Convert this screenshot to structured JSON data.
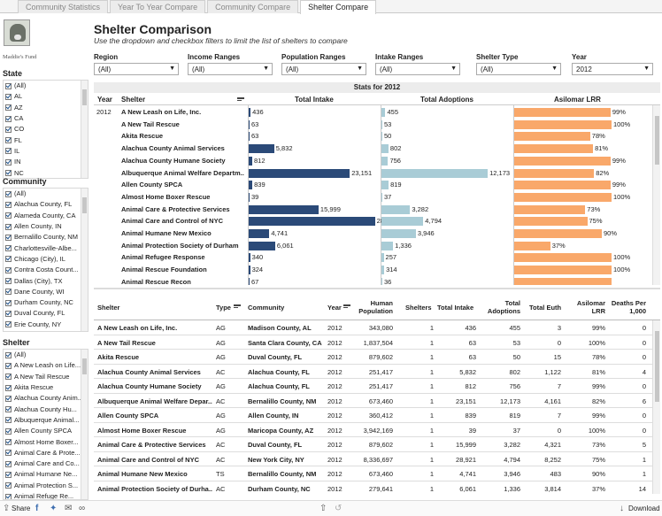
{
  "tabs": [
    {
      "label": "Community Statistics"
    },
    {
      "label": "Year To Year Compare"
    },
    {
      "label": "Community Compare"
    },
    {
      "label": "Shelter Compare"
    }
  ],
  "logo_text": "Maddie's Fund",
  "page_title": "Shelter Comparison",
  "subtitle": "Use the dropdown and checkbox filters to limit the list of shelters to compare",
  "filters": {
    "state": {
      "title": "State",
      "items": [
        "(All)",
        "AL",
        "AZ",
        "CA",
        "CO",
        "FL",
        "IL",
        "IN",
        "NC"
      ]
    },
    "community": {
      "title": "Community",
      "items": [
        "(All)",
        "Alachua County, FL",
        "Alameda County, CA",
        "Allen County, IN",
        "Bernalillo County, NM",
        "Charlottesville-Albe...",
        "Chicago (City), IL",
        "Contra Costa Count...",
        "Dallas (City), TX",
        "Dane County, WI",
        "Durham County, NC",
        "Duval County, FL",
        "Erie County, NY",
        "Harris County, TX"
      ]
    },
    "shelter": {
      "title": "Shelter",
      "items": [
        "(All)",
        "A New Leash on Life...",
        "A New Tail Rescue",
        "Akita Rescue",
        "Alachua County Anim...",
        "Alachua County Hu...",
        "Albuquerque Animal...",
        "Allen County SPCA",
        "Almost Home Boxer...",
        "Animal Care & Prote...",
        "Animal Care and Co...",
        "Animal Humane Ne...",
        "Animal Protection S...",
        "Animal Refuge Re..."
      ]
    }
  },
  "dropdowns": [
    {
      "label": "Region",
      "value": "(All)"
    },
    {
      "label": "Income Ranges",
      "value": "(All)"
    },
    {
      "label": "Population Ranges",
      "value": "(All)"
    },
    {
      "label": "Intake Ranges",
      "value": "(All)"
    },
    {
      "label": "Shelter Type",
      "value": "(All)"
    },
    {
      "label": "Year",
      "value": "2012"
    }
  ],
  "stats_header": "Stats for 2012",
  "chart_columns": {
    "year": "Year",
    "shelter": "Shelter",
    "intake": "Total Intake",
    "adoptions": "Total Adoptions",
    "lrr": "Asilomar LRR"
  },
  "chart_year": "2012",
  "chart_data": {
    "type": "bar",
    "title": "Stats for 2012",
    "categories": [
      "A New Leash on Life, Inc.",
      "A New Tail Rescue",
      "Akita Rescue",
      "Alachua County Animal Services",
      "Alachua County Humane Society",
      "Albuquerque Animal Welfare Departm..",
      "Allen County SPCA",
      "Almost Home Boxer Rescue",
      "Animal Care & Protective Services",
      "Animal Care and Control of NYC",
      "Animal Humane New Mexico",
      "Animal Protection Society of Durham",
      "Animal Refugee Response",
      "Animal Rescue Foundation",
      "Animal Rescue Recon"
    ],
    "series": [
      {
        "name": "Total Intake",
        "values": [
          436,
          63,
          63,
          5832,
          812,
          23151,
          839,
          39,
          15999,
          28921,
          4741,
          6061,
          340,
          324,
          67
        ],
        "labels": [
          "436",
          "63",
          "63",
          "5,832",
          "812",
          "23,151",
          "839",
          "39",
          "15,999",
          "28,921",
          "4,741",
          "6,061",
          "340",
          "324",
          "67"
        ],
        "color": "#2b4a78",
        "max": 30000
      },
      {
        "name": "Total Adoptions",
        "values": [
          455,
          53,
          50,
          802,
          756,
          12173,
          819,
          37,
          3282,
          4794,
          3946,
          1336,
          257,
          314,
          36
        ],
        "labels": [
          "455",
          "53",
          "50",
          "802",
          "756",
          "12,173",
          "819",
          "37",
          "3,282",
          "4,794",
          "3,946",
          "1,336",
          "257",
          "314",
          "36"
        ],
        "color": "#a9ccd6",
        "max": 15000
      },
      {
        "name": "Asilomar LRR",
        "values": [
          99,
          100,
          78,
          81,
          99,
          82,
          99,
          100,
          73,
          75,
          90,
          37,
          100,
          100,
          100
        ],
        "labels": [
          "99%",
          "100%",
          "78%",
          "81%",
          "99%",
          "82%",
          "99%",
          "100%",
          "73%",
          "75%",
          "90%",
          "37%",
          "100%",
          "100%",
          ""
        ],
        "color": "#f9a86a",
        "max": 100
      }
    ]
  },
  "table": {
    "headers": [
      "Shelter",
      "Type",
      "Community",
      "Year",
      "Human Population",
      "Shelters",
      "Total Intake",
      "Total Adoptions",
      "Total Euth",
      "Asilomar LRR",
      "Deaths Per 1,000"
    ],
    "rows": [
      [
        "A New Leash on Life, Inc.",
        "AG",
        "Madison County, AL",
        "2012",
        "343,080",
        "1",
        "436",
        "455",
        "3",
        "99%",
        "0"
      ],
      [
        "A New Tail Rescue",
        "AG",
        "Santa Clara County, CA",
        "2012",
        "1,837,504",
        "1",
        "63",
        "53",
        "0",
        "100%",
        "0"
      ],
      [
        "Akita Rescue",
        "AG",
        "Duval County, FL",
        "2012",
        "879,602",
        "1",
        "63",
        "50",
        "15",
        "78%",
        "0"
      ],
      [
        "Alachua County Animal Services",
        "AC",
        "Alachua County, FL",
        "2012",
        "251,417",
        "1",
        "5,832",
        "802",
        "1,122",
        "81%",
        "4"
      ],
      [
        "Alachua County Humane Society",
        "AG",
        "Alachua County, FL",
        "2012",
        "251,417",
        "1",
        "812",
        "756",
        "7",
        "99%",
        "0"
      ],
      [
        "Albuquerque Animal Welfare Depar...",
        "AC",
        "Bernalillo County, NM",
        "2012",
        "673,460",
        "1",
        "23,151",
        "12,173",
        "4,161",
        "82%",
        "6"
      ],
      [
        "Allen County SPCA",
        "AG",
        "Allen County, IN",
        "2012",
        "360,412",
        "1",
        "839",
        "819",
        "7",
        "99%",
        "0"
      ],
      [
        "Almost Home Boxer Rescue",
        "AG",
        "Maricopa County, AZ",
        "2012",
        "3,942,169",
        "1",
        "39",
        "37",
        "0",
        "100%",
        "0"
      ],
      [
        "Animal Care & Protective Services",
        "AC",
        "Duval County, FL",
        "2012",
        "879,602",
        "1",
        "15,999",
        "3,282",
        "4,321",
        "73%",
        "5"
      ],
      [
        "Animal Care and Control of NYC",
        "AC",
        "New York City, NY",
        "2012",
        "8,336,697",
        "1",
        "28,921",
        "4,794",
        "8,252",
        "75%",
        "1"
      ],
      [
        "Animal Humane New Mexico",
        "TS",
        "Bernalillo County, NM",
        "2012",
        "673,460",
        "1",
        "4,741",
        "3,946",
        "483",
        "90%",
        "1"
      ],
      [
        "Animal Protection Society of Durha...",
        "AC",
        "Durham County, NC",
        "2012",
        "279,641",
        "1",
        "6,061",
        "1,336",
        "3,814",
        "37%",
        "14"
      ]
    ]
  },
  "footer": {
    "share": "Share",
    "download": "Download"
  }
}
